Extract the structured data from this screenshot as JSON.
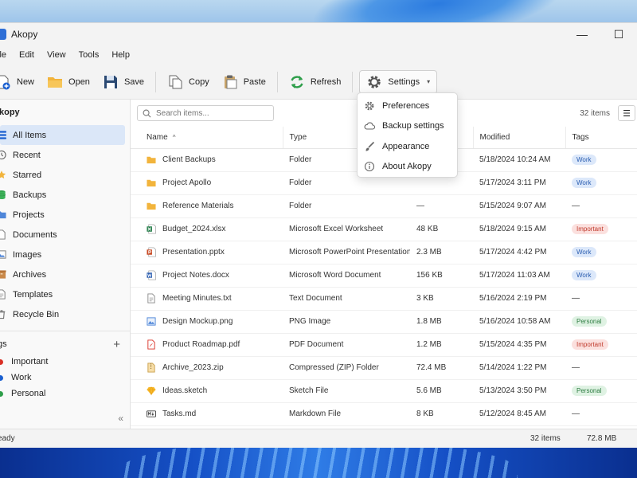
{
  "app": {
    "title": "Akopy"
  },
  "window_controls": {
    "minimize": "—",
    "maximize": "☐"
  },
  "menu": [
    "ile",
    "Edit",
    "View",
    "Tools",
    "Help"
  ],
  "toolbar": {
    "new_label": "New",
    "open_label": "Open",
    "save_label": "Save",
    "copy_label": "Copy",
    "paste_label": "Paste",
    "refresh_label": "Refresh",
    "settings_label": "Settings"
  },
  "settings_menu": {
    "items": [
      "Preferences",
      "Backup settings",
      "Appearance",
      "About Akopy"
    ]
  },
  "sidebar": {
    "header": "kopy",
    "items": [
      {
        "label": "All Items",
        "icon": "list-icon",
        "active": true
      },
      {
        "label": "Recent",
        "icon": "clock-icon"
      },
      {
        "label": "Starred",
        "icon": "star-icon"
      },
      {
        "label": "Backups",
        "icon": "database-icon"
      },
      {
        "label": "Projects",
        "icon": "folder-icon"
      },
      {
        "label": "Documents",
        "icon": "document-icon"
      },
      {
        "label": "Images",
        "icon": "image-icon"
      },
      {
        "label": "Archives",
        "icon": "archive-icon"
      },
      {
        "label": "Templates",
        "icon": "template-icon"
      },
      {
        "label": "Recycle Bin",
        "icon": "trash-icon"
      }
    ],
    "tags_header": "gs",
    "tags": [
      {
        "label": "Important",
        "color": "#d93025"
      },
      {
        "label": "Work",
        "color": "#1a5fd0"
      },
      {
        "label": "Personal",
        "color": "#2e9e4a"
      }
    ],
    "collapse_glyph": "«"
  },
  "search": {
    "placeholder": "Search items...",
    "count": "32 items"
  },
  "table": {
    "columns": [
      "Name",
      "Type",
      "",
      "Modified",
      "Tags"
    ],
    "rows": [
      {
        "name": "Client Backups",
        "type": "Folder",
        "size": "",
        "modified": "5/18/2024 10:24 AM",
        "tag": "Work",
        "icon": "folder"
      },
      {
        "name": "Project Apollo",
        "type": "Folder",
        "size": "",
        "modified": "5/17/2024 3:11 PM",
        "tag": "Work",
        "icon": "folder"
      },
      {
        "name": "Reference Materials",
        "type": "Folder",
        "size": "—",
        "modified": "5/15/2024 9:07 AM",
        "tag": "—",
        "icon": "folder"
      },
      {
        "name": "Budget_2024.xlsx",
        "type": "Microsoft Excel Worksheet",
        "size": "48 KB",
        "modified": "5/18/2024 9:15 AM",
        "tag": "Important",
        "icon": "excel"
      },
      {
        "name": "Presentation.pptx",
        "type": "Microsoft PowerPoint Presentation",
        "size": "2.3 MB",
        "modified": "5/17/2024 4:42 PM",
        "tag": "Work",
        "icon": "powerpoint"
      },
      {
        "name": "Project Notes.docx",
        "type": "Microsoft Word Document",
        "size": "156 KB",
        "modified": "5/17/2024 11:03 AM",
        "tag": "Work",
        "icon": "word"
      },
      {
        "name": "Meeting Minutes.txt",
        "type": "Text Document",
        "size": "3 KB",
        "modified": "5/16/2024 2:19 PM",
        "tag": "—",
        "icon": "text"
      },
      {
        "name": "Design Mockup.png",
        "type": "PNG Image",
        "size": "1.8 MB",
        "modified": "5/16/2024 10:58 AM",
        "tag": "Personal",
        "icon": "image"
      },
      {
        "name": "Product Roadmap.pdf",
        "type": "PDF Document",
        "size": "1.2 MB",
        "modified": "5/15/2024 4:35 PM",
        "tag": "Important",
        "icon": "pdf"
      },
      {
        "name": "Archive_2023.zip",
        "type": "Compressed (ZIP) Folder",
        "size": "72.4 MB",
        "modified": "5/14/2024 1:22 PM",
        "tag": "—",
        "icon": "zip"
      },
      {
        "name": "Ideas.sketch",
        "type": "Sketch File",
        "size": "5.6 MB",
        "modified": "5/13/2024 3:50 PM",
        "tag": "Personal",
        "icon": "sketch"
      },
      {
        "name": "Tasks.md",
        "type": "Markdown File",
        "size": "8 KB",
        "modified": "5/12/2024 8:45 AM",
        "tag": "—",
        "icon": "markdown"
      }
    ]
  },
  "status": {
    "left": "eady",
    "count": "32 items",
    "size": "72.8 MB"
  },
  "colors": {
    "accent": "#1a5fd0",
    "active_bg": "#dbe7f8",
    "folder": "#f2b43c"
  }
}
